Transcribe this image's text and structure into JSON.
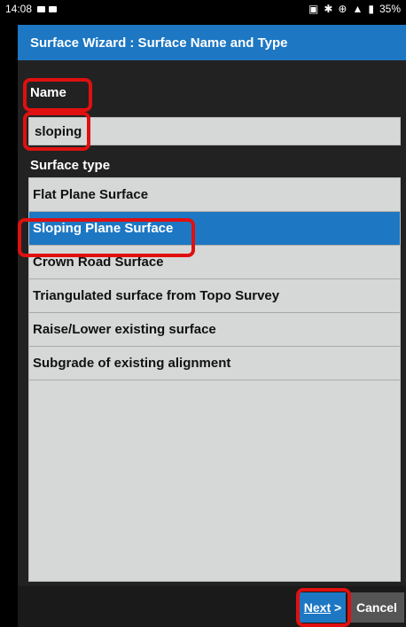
{
  "status_bar": {
    "time": "14:08",
    "battery": "35%"
  },
  "wizard": {
    "title": "Surface Wizard : Surface Name and Type"
  },
  "form": {
    "name_label": "Name",
    "name_value": "sloping",
    "surface_type_label": "Surface type"
  },
  "surface_types": [
    "Flat Plane Surface",
    "Sloping Plane Surface",
    "Crown Road Surface",
    "Triangulated surface from Topo Survey",
    "Raise/Lower existing surface",
    "Subgrade of existing alignment"
  ],
  "selected_surface_type": "Sloping Plane Surface",
  "buttons": {
    "next_label": "Next",
    "next_suffix": " >",
    "cancel_label": "Cancel"
  },
  "colors": {
    "accent": "#1d77c3",
    "highlight": "#e01010"
  }
}
